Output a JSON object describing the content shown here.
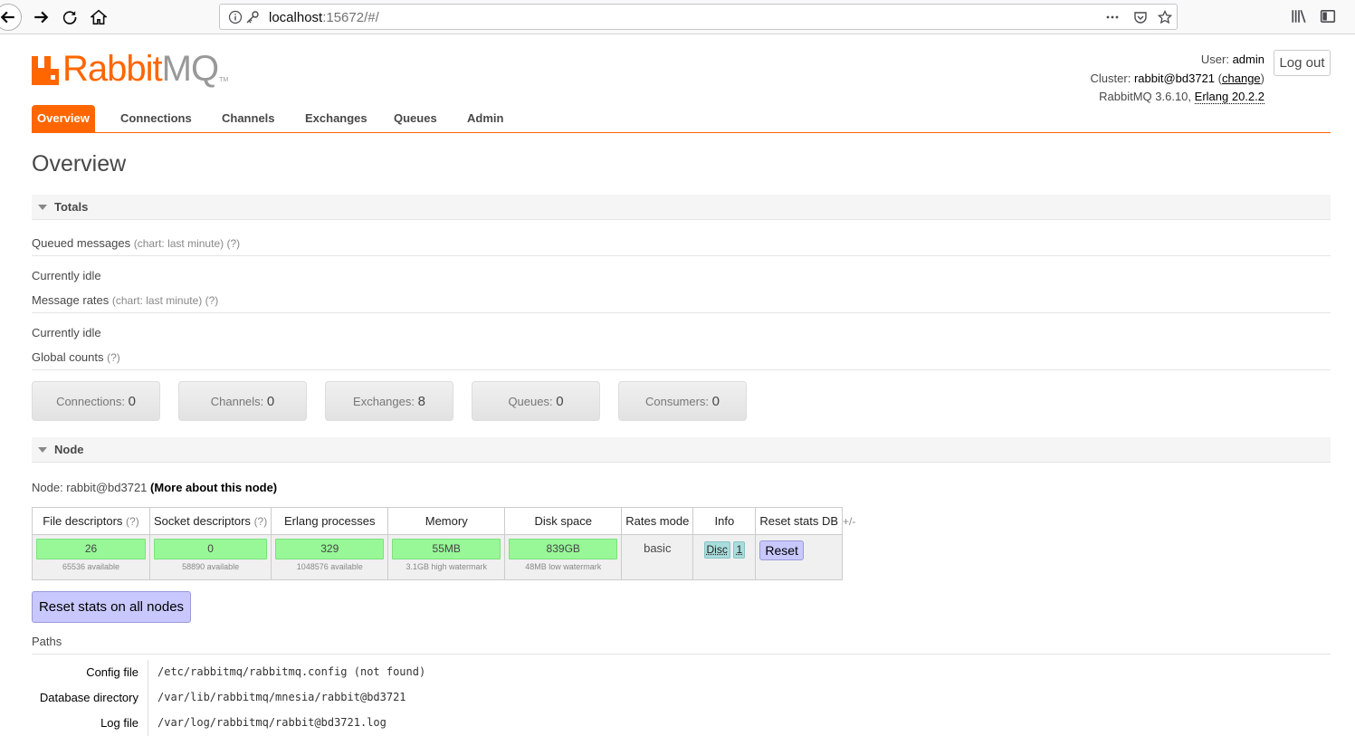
{
  "browser": {
    "url_host": "localhost",
    "url_rest": ":15672/#/"
  },
  "header": {
    "logo_rabbit": "Rabbit",
    "logo_mq": "MQ",
    "logo_tm": "TM",
    "user_label": "User:",
    "user_value": "admin",
    "cluster_label": "Cluster:",
    "cluster_value": "rabbit@bd3721",
    "cluster_change": "change",
    "version_text": "RabbitMQ 3.6.10,",
    "erlang_text": "Erlang 20.2.2",
    "logout_label": "Log out"
  },
  "tabs": [
    {
      "label": "Overview"
    },
    {
      "label": "Connections"
    },
    {
      "label": "Channels"
    },
    {
      "label": "Exchanges"
    },
    {
      "label": "Queues"
    },
    {
      "label": "Admin"
    }
  ],
  "page_title": "Overview",
  "totals": {
    "heading": "Totals",
    "queued_label": "Queued messages",
    "queued_help": "(chart: last minute) (?)",
    "queued_status": "Currently idle",
    "rates_label": "Message rates",
    "rates_help": "(chart: last minute) (?)",
    "rates_status": "Currently idle",
    "global_label": "Global counts",
    "global_help": "(?)",
    "counts": [
      {
        "label": "Connections:",
        "value": "0"
      },
      {
        "label": "Channels:",
        "value": "0"
      },
      {
        "label": "Exchanges:",
        "value": "8"
      },
      {
        "label": "Queues:",
        "value": "0"
      },
      {
        "label": "Consumers:",
        "value": "0"
      }
    ]
  },
  "node": {
    "heading": "Node",
    "node_prefix": "Node: rabbit@bd3721",
    "more_link": "(More about this node)",
    "columns": {
      "fd": "File descriptors",
      "sd": "Socket descriptors",
      "ep": "Erlang processes",
      "mem": "Memory",
      "disk": "Disk space",
      "rates": "Rates mode",
      "info": "Info",
      "reset": "Reset stats DB",
      "help": "(?)"
    },
    "values": {
      "fd": "26",
      "fd_sub": "65536 available",
      "sd": "0",
      "sd_sub": "58890 available",
      "ep": "329",
      "ep_sub": "1048576 available",
      "mem": "55MB",
      "mem_sub": "3.1GB high watermark",
      "disk": "839GB",
      "disk_sub": "48MB low watermark",
      "rates": "basic",
      "info_disc": "Disc",
      "info_num": "1",
      "reset_label": "Reset"
    },
    "plusminus": "+/-",
    "reset_all_label": "Reset stats on all nodes"
  },
  "paths": {
    "heading": "Paths",
    "rows": [
      {
        "label": "Config file",
        "value": "/etc/rabbitmq/rabbitmq.config (not found)"
      },
      {
        "label": "Database directory",
        "value": "/var/lib/rabbitmq/mnesia/rabbit@bd3721"
      },
      {
        "label": "Log file",
        "value": "/var/log/rabbitmq/rabbit@bd3721.log"
      }
    ]
  },
  "colors": {
    "accent": "#ff6600",
    "gauge_green": "#98f898",
    "button_purple": "#c8c8ff"
  }
}
